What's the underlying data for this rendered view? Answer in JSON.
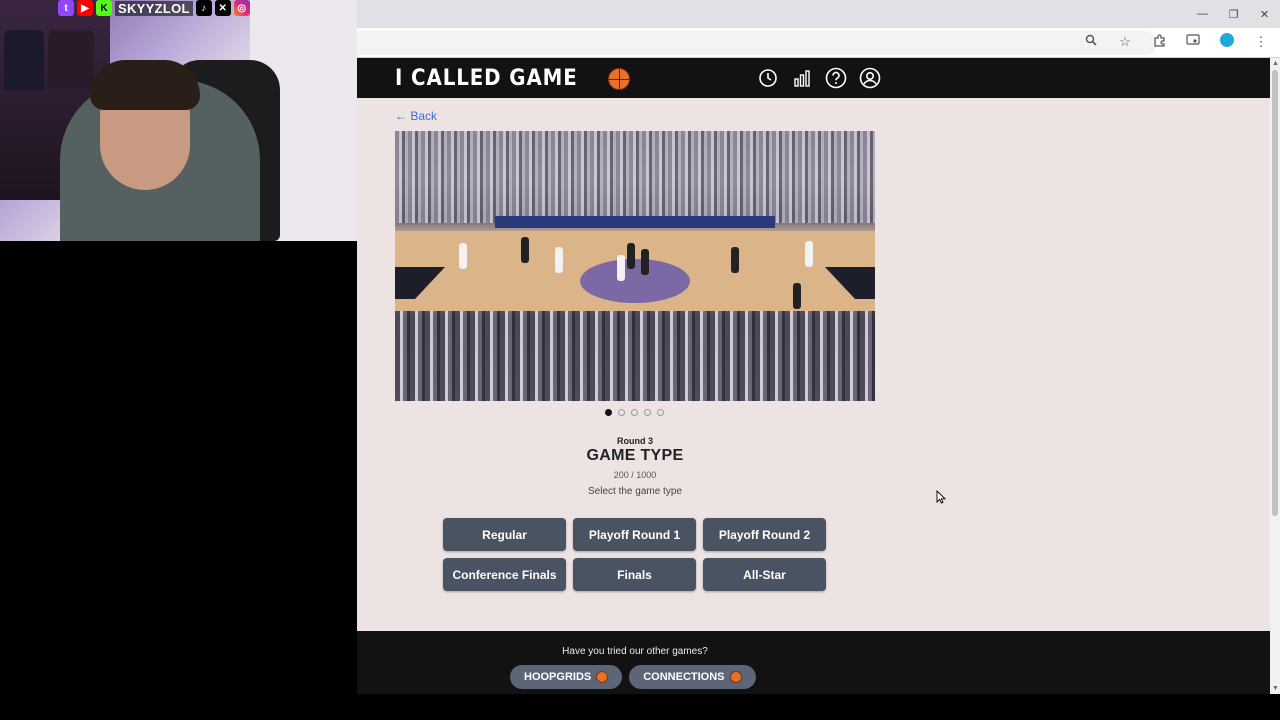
{
  "stream_overlay": {
    "handle": "SKYYZLOL",
    "socials": [
      "twitch-icon",
      "youtube-icon",
      "kick-icon",
      "tiktok-icon",
      "x-icon",
      "instagram-icon"
    ]
  },
  "browser": {
    "window_controls": [
      "—",
      "❐",
      "✕"
    ],
    "toolbar_icons": [
      "zoom-icon",
      "star-icon",
      "extensions-icon",
      "cast-icon",
      "profile-icon",
      "menu-icon"
    ]
  },
  "header": {
    "logo_text": "I CALLED GAME",
    "icons": [
      "history-icon",
      "stats-icon",
      "help-icon",
      "account-icon"
    ]
  },
  "back_link": "← Back",
  "carousel": {
    "slides": 5,
    "active": 0
  },
  "question": {
    "round": "Round 3",
    "title": "GAME TYPE",
    "score": "200 / 1000",
    "instruction": "Select the game type"
  },
  "options": [
    "Regular",
    "Playoff Round 1",
    "Playoff Round 2",
    "Conference Finals",
    "Finals",
    "All-Star"
  ],
  "footer": {
    "prompt": "Have you tried our other games?",
    "games": [
      "HOOPGRIDS",
      "CONNECTIONS"
    ]
  },
  "colors": {
    "page_bg": "#ede3e2",
    "nav_bg": "#121212",
    "option_bg": "#4a5361",
    "footer_btn_bg": "#5c6676",
    "link": "#3b6fd0",
    "accent_ball": "#e8702a"
  }
}
